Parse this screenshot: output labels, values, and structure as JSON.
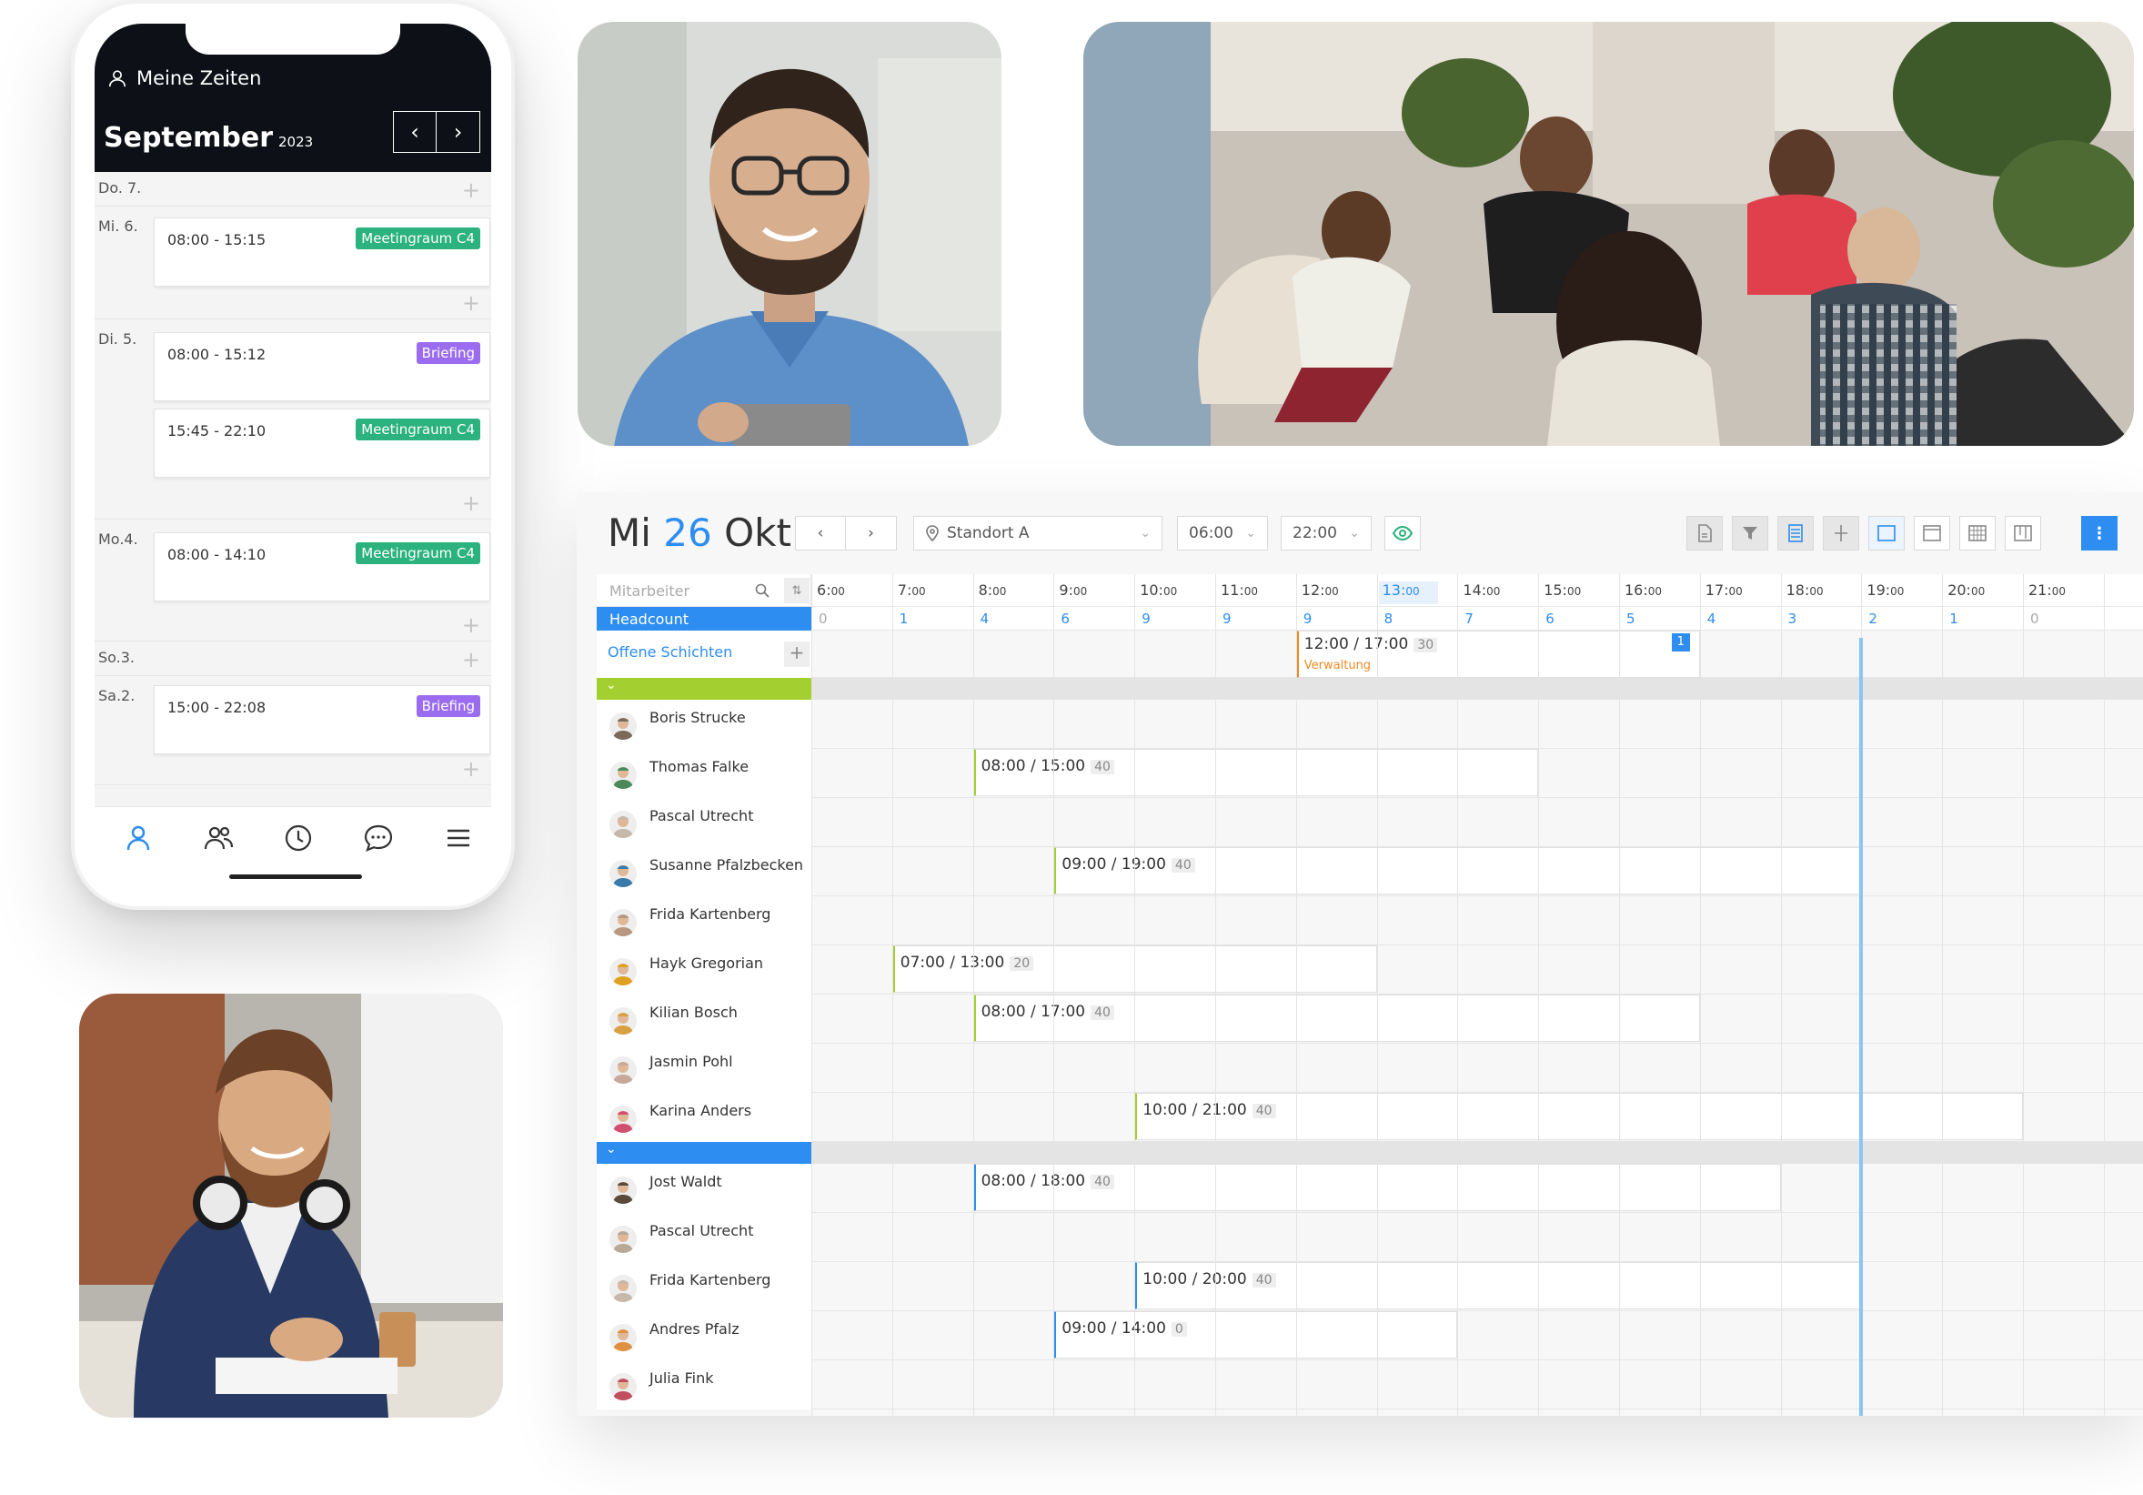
{
  "phone": {
    "header_title": "Meine Zeiten",
    "month": "September",
    "year": "2023",
    "prev_icon": "chevron-left-icon",
    "next_icon": "chevron-right-icon",
    "days": [
      {
        "label": "Do. 7.",
        "entries": []
      },
      {
        "label": "Mi. 6.",
        "entries": [
          {
            "time": "08:00 - 15:15",
            "tag": "Meetingraum C4",
            "tag_color": "#2bb27e"
          }
        ]
      },
      {
        "label": "Di.  5.",
        "entries": [
          {
            "time": "08:00 - 15:12",
            "tag": "Briefing",
            "tag_color": "#9b6cf0"
          },
          {
            "time": "15:45 - 22:10",
            "tag": "Meetingraum C4",
            "tag_color": "#2bb27e"
          }
        ]
      },
      {
        "label": "Mo.4.",
        "entries": [
          {
            "time": "08:00 - 14:10",
            "tag": "Meetingraum C4",
            "tag_color": "#2bb27e"
          }
        ]
      },
      {
        "label": "So.3.",
        "entries": []
      },
      {
        "label": "Sa.2.",
        "entries": [
          {
            "time": "15:00 - 22:08",
            "tag": "Briefing",
            "tag_color": "#9b6cf0"
          }
        ]
      }
    ],
    "tabs": [
      "user-icon",
      "team-icon",
      "clock-icon",
      "chat-icon",
      "menu-icon"
    ],
    "accent": "#2d8df0"
  },
  "scheduler": {
    "weekday": "Mi",
    "day": "26",
    "month": "Okt",
    "location": "Standort A",
    "start_time": "06:00",
    "end_time": "22:00",
    "search_placeholder": "Mitarbeiter",
    "headcount_label": "Headcount",
    "open_shifts_label": "Offene Schichten",
    "hours": [
      {
        "h": "6",
        "m": "00"
      },
      {
        "h": "7",
        "m": "00"
      },
      {
        "h": "8",
        "m": "00"
      },
      {
        "h": "9",
        "m": "00"
      },
      {
        "h": "10",
        "m": "00"
      },
      {
        "h": "11",
        "m": "00"
      },
      {
        "h": "12",
        "m": "00"
      },
      {
        "h": "13",
        "m": "00"
      },
      {
        "h": "14",
        "m": "00"
      },
      {
        "h": "15",
        "m": "00"
      },
      {
        "h": "16",
        "m": "00"
      },
      {
        "h": "17",
        "m": "00"
      },
      {
        "h": "18",
        "m": "00"
      },
      {
        "h": "19",
        "m": "00"
      },
      {
        "h": "20",
        "m": "00"
      },
      {
        "h": "21",
        "m": "00"
      }
    ],
    "headcount": [
      "0",
      "1",
      "4",
      "6",
      "9",
      "9",
      "9",
      "8",
      "7",
      "6",
      "5",
      "4",
      "3",
      "2",
      "1",
      "0"
    ],
    "open_shift": {
      "time": "12:00 / 17:00",
      "count": "30",
      "dept": "Verwaltung",
      "badge": "1"
    },
    "groups": [
      {
        "color": "#a4cf30",
        "rows": [
          {
            "name": "Boris Strucke",
            "shift": null
          },
          {
            "name": "Thomas Falke",
            "shift": {
              "time": "08:00 / 15:00",
              "count": "40",
              "start": 8,
              "end": 15
            }
          },
          {
            "name": "Pascal Utrecht",
            "shift": null
          },
          {
            "name": "Susanne Pfalzbecken",
            "shift": {
              "time": "09:00 / 19:00",
              "count": "40",
              "start": 9,
              "end": 19
            }
          },
          {
            "name": "Frida Kartenberg",
            "shift": null
          },
          {
            "name": "Hayk Gregorian",
            "shift": {
              "time": "07:00 / 13:00",
              "count": "20",
              "start": 7,
              "end": 13
            }
          },
          {
            "name": "Kilian Bosch",
            "shift": {
              "time": "08:00 / 17:00",
              "count": "40",
              "start": 8,
              "end": 17
            }
          },
          {
            "name": "Jasmin Pohl",
            "shift": null
          },
          {
            "name": "Karina Anders",
            "shift": {
              "time": "10:00 / 21:00",
              "count": "40",
              "start": 10,
              "end": 21
            }
          }
        ]
      },
      {
        "color": "#2d8df0",
        "rows": [
          {
            "name": "Jost Waldt",
            "shift": {
              "time": "08:00 / 18:00",
              "count": "40",
              "start": 8,
              "end": 18
            }
          },
          {
            "name": "Pascal Utrecht",
            "shift": null
          },
          {
            "name": "Frida Kartenberg",
            "shift": {
              "time": "10:00 / 20:00",
              "count": "40",
              "start": 10,
              "end": 19
            }
          },
          {
            "name": "Andres Pfalz",
            "shift": {
              "time": "09:00 / 14:00",
              "count": "0",
              "start": 9,
              "end": 14
            }
          },
          {
            "name": "Julia Fink",
            "shift": null
          }
        ]
      }
    ]
  }
}
